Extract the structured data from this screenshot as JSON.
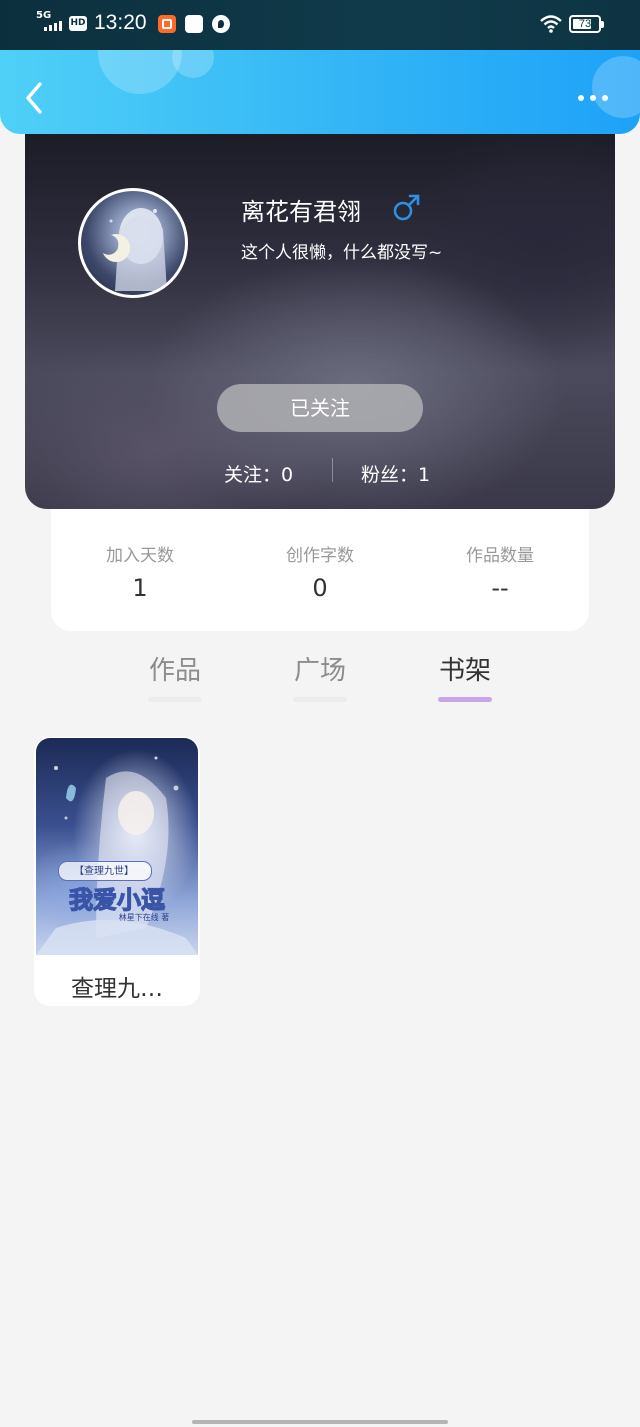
{
  "status_bar": {
    "network": "5G",
    "hd_badge": "HD",
    "time": "13:20",
    "battery": "73",
    "battery_level": 0.73
  },
  "header": {
    "back_icon": "chevron-left-icon",
    "more_icon": "more-horizontal-icon"
  },
  "profile": {
    "name": "离花有君翎",
    "gender_icon": "male-icon",
    "gender_color": "#2f8fe0",
    "bio": "这个人很懒，什么都没写~",
    "follow_button": "已关注",
    "following": "关注：0",
    "fans": "粉丝：1"
  },
  "stats": [
    {
      "label": "加入天数",
      "value": "1"
    },
    {
      "label": "创作字数",
      "value": "0"
    },
    {
      "label": "作品数量",
      "value": "--"
    }
  ],
  "tabs": [
    {
      "label": "作品",
      "active": false
    },
    {
      "label": "广场",
      "active": false
    },
    {
      "label": "书架",
      "active": true
    }
  ],
  "bookshelf": [
    {
      "title": "查理九…",
      "cover": {
        "banner": "【查理九世】",
        "title": "我爱小逗",
        "author": "林星下在线 著"
      }
    }
  ],
  "colors": {
    "header_gradient": [
      "#4fd0f7",
      "#1ea2f8"
    ],
    "active_tab_underline": "#c8a6e6"
  }
}
